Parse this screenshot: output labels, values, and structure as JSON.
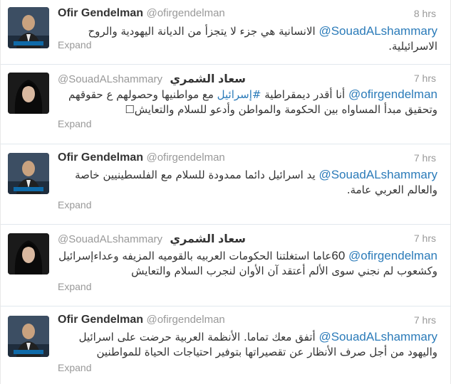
{
  "colors": {
    "link": "#2b7bb9",
    "muted": "#999999",
    "text": "#333333"
  },
  "tweets": [
    {
      "name": "Ofir Gendelman",
      "screen_name": "@ofirgendelman",
      "time": "8 hrs",
      "mention": "@SouadALshammary",
      "text": " الانسانية هي جزء لا يتجزأ من الديانة اليهودية والروح الاسرائيلية.",
      "expand": "Expand"
    },
    {
      "name": "سعاد الشمري",
      "screen_name": "@SouadALshammary",
      "time": "7 hrs",
      "mention": "@ofirgendelman",
      "text_a": " أنا أقدر ديمقراطية ",
      "hashtag": "#إسرائيل",
      "text_b": " مع مواطنيها وحصولهم ع حقوقهم وتحقيق مبدأ المساواه بين الحكومة والمواطن وأدعو للسلام والتعايش☐",
      "expand": "Expand"
    },
    {
      "name": "Ofir Gendelman",
      "screen_name": "@ofirgendelman",
      "time": "7 hrs",
      "mention": "@SouadALshammary",
      "text": " يد اسرائيل دائما ممدودة للسلام مع الفلسطينيين خاصة والعالم العربي عامة.",
      "expand": "Expand"
    },
    {
      "name": "سعاد الشمري",
      "screen_name": "@SouadALshammary",
      "time": "7 hrs",
      "prefix": "60 ",
      "mention": "@ofirgendelman",
      "text": "عاما استغلتنا الحكومات العربيه بالقوميه المزيفه وعداءإسرائيل وكشعوب لم نجني سوى الألم أعتقد آن الأوان لنجرب السلام والتعايش",
      "expand": "Expand"
    },
    {
      "name": "Ofir Gendelman",
      "screen_name": "@ofirgendelman",
      "time": "7 hrs",
      "mention": "@SouadALshammary",
      "text": " أتفق معك تماما. الأنظمة العربية حرضت على اسرائيل واليهود من أجل صرف الأنظار عن تقصيراتها بتوفير احتياجات الحياة للمواطنين",
      "expand": "Expand"
    }
  ]
}
